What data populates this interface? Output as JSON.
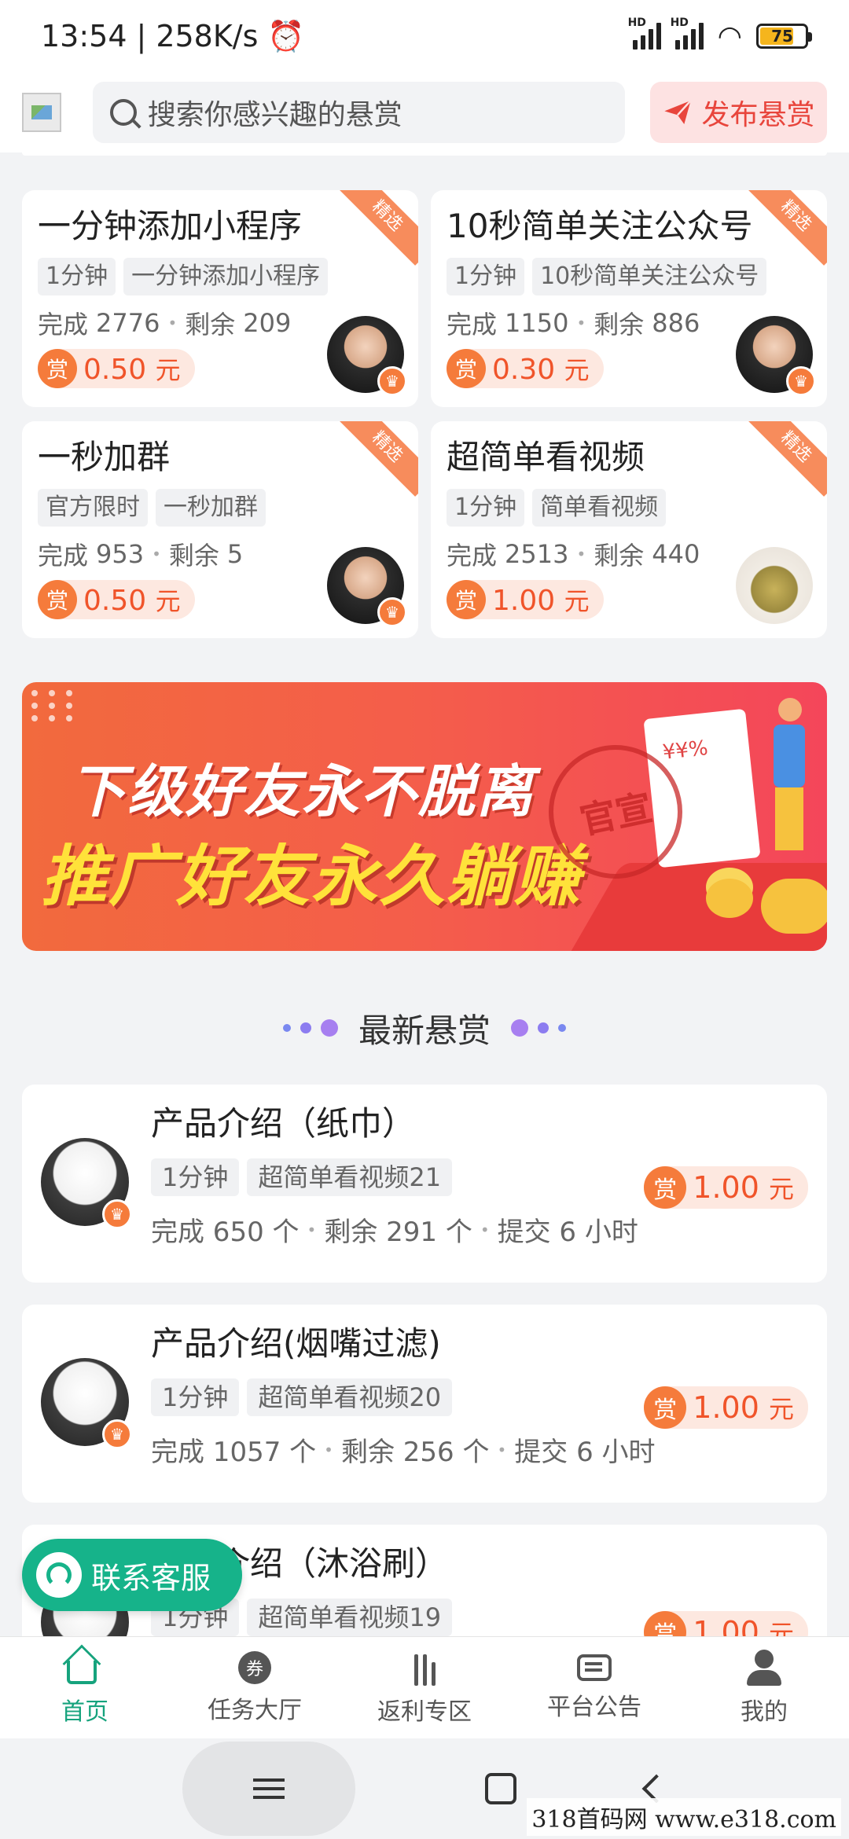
{
  "status_bar": {
    "time": "13:54",
    "net_speed": "258K/s",
    "battery": "75"
  },
  "header": {
    "search_placeholder": "搜索你感兴趣的悬赏",
    "publish_label": "发布悬赏"
  },
  "featured": [
    {
      "title": "一分钟添加小程序",
      "tags": [
        "1分钟",
        "一分钟添加小程序"
      ],
      "done_label": "完成",
      "done": "2776",
      "left_label": "剩余",
      "left": "209",
      "shang": "赏",
      "amount": "0.50",
      "unit": "元",
      "ribbon": "精选"
    },
    {
      "title": "10秒简单关注公众号",
      "tags": [
        "1分钟",
        "10秒简单关注公众号"
      ],
      "done_label": "完成",
      "done": "1150",
      "left_label": "剩余",
      "left": "886",
      "shang": "赏",
      "amount": "0.30",
      "unit": "元",
      "ribbon": "精选"
    },
    {
      "title": "一秒加群",
      "tags": [
        "官方限时",
        "一秒加群"
      ],
      "done_label": "完成",
      "done": "953",
      "left_label": "剩余",
      "left": "5",
      "shang": "赏",
      "amount": "0.50",
      "unit": "元",
      "ribbon": "精选"
    },
    {
      "title": "超简单看视频",
      "tags": [
        "1分钟",
        "简单看视频"
      ],
      "done_label": "完成",
      "done": "2513",
      "left_label": "剩余",
      "left": "440",
      "shang": "赏",
      "amount": "1.00",
      "unit": "元",
      "ribbon": "精选"
    }
  ],
  "banner": {
    "line1": "下级好友永不脱离",
    "line2": "推广好友永久躺赚",
    "seal": "官宣",
    "paper_text": "¥¥%"
  },
  "section": {
    "title": "最新悬赏"
  },
  "latest": [
    {
      "title": "产品介绍（纸巾）",
      "tags": [
        "1分钟",
        "超简单看视频21"
      ],
      "stats": "完成 650 个",
      "left": "剩余 291 个",
      "submit": "提交 6 小时",
      "shang": "赏",
      "amount": "1.00",
      "unit": "元"
    },
    {
      "title": "产品介绍(烟嘴过滤)",
      "tags": [
        "1分钟",
        "超简单看视频20"
      ],
      "stats": "完成 1057 个",
      "left": "剩余 256 个",
      "submit": "提交 6 小时",
      "shang": "赏",
      "amount": "1.00",
      "unit": "元"
    },
    {
      "title": "产品介绍（沐浴刷）",
      "tags": [
        "1分钟",
        "超简单看视频19"
      ],
      "shang": "赏",
      "amount": "1.00",
      "unit": "元"
    }
  ],
  "cs_button": {
    "label": "联系客服"
  },
  "bottom_nav": [
    {
      "label": "首页"
    },
    {
      "label": "任务大厅"
    },
    {
      "label": "返利专区"
    },
    {
      "label": "平台公告"
    },
    {
      "label": "我的"
    }
  ],
  "task_icon_char": "券",
  "watermark": "318首码网 www.e318.com",
  "colors": {
    "accent": "#16a37d",
    "reward": "#f0542a",
    "ribbon": "#f78c5c"
  }
}
